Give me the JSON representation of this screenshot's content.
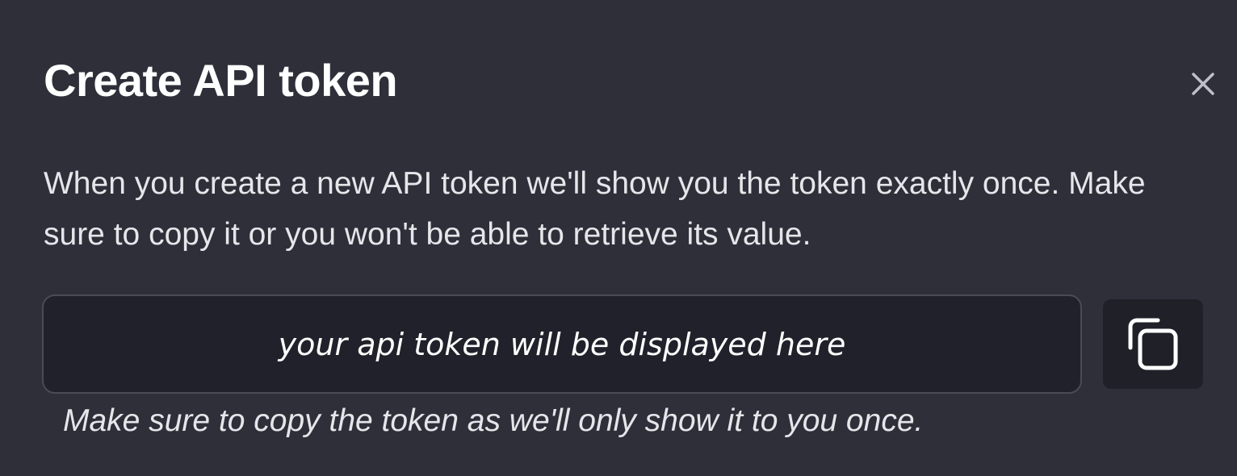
{
  "dialog": {
    "title": "Create API token",
    "description": "When you create a new API token we'll show you the token exactly once. Make sure to copy it or you won't be able to retrieve its value.",
    "close_icon": "close-icon",
    "token_field": {
      "placeholder": "your api token will be displayed here"
    },
    "copy_button": {
      "icon": "copy-icon"
    },
    "hint": "Make sure to copy the token as we'll only show it to you once."
  }
}
